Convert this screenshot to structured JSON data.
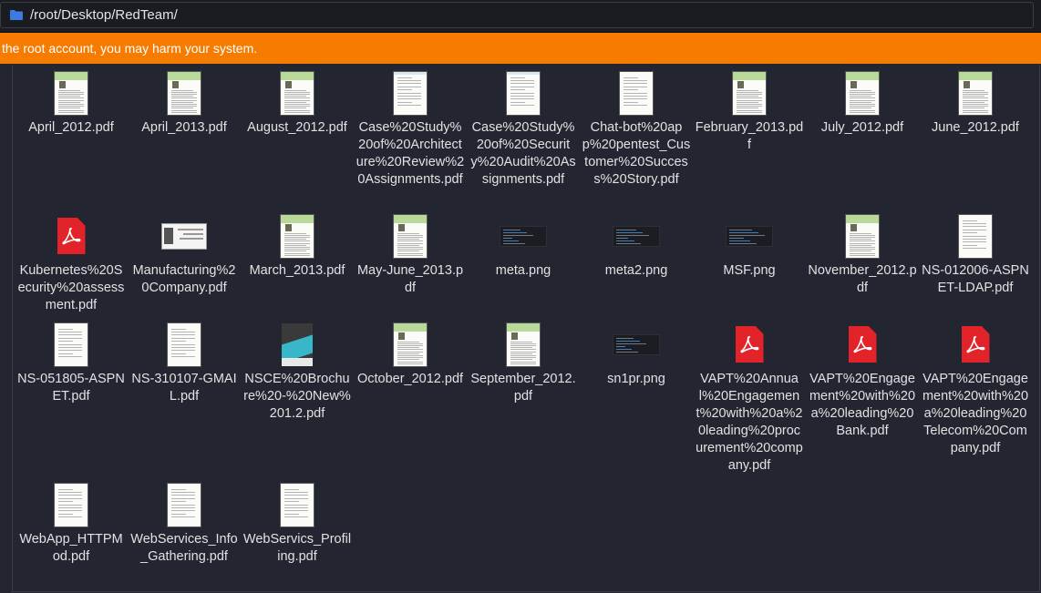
{
  "path": "/root/Desktop/RedTeam/",
  "warning": "the root account, you may harm your system.",
  "files": [
    {
      "name": "April_2012.pdf",
      "kind": "newsletter"
    },
    {
      "name": "April_2013.pdf",
      "kind": "newsletter"
    },
    {
      "name": "August_2012.pdf",
      "kind": "newsletter"
    },
    {
      "name": "Case%20Study%20of%20Architecture%20Review%20Assignments.pdf",
      "kind": "blue"
    },
    {
      "name": "Case%20Study%20of%20Security%20Audit%20Assignments.pdf",
      "kind": "blue"
    },
    {
      "name": "Chat-bot%20app%20pentest_Customer%20Success%20Story.pdf",
      "kind": "plain"
    },
    {
      "name": "February_2013.pdf",
      "kind": "newsletter"
    },
    {
      "name": "July_2012.pdf",
      "kind": "newsletter"
    },
    {
      "name": "June_2012.pdf",
      "kind": "newsletter"
    },
    {
      "name": "Kubernetes%20Security%20assessment.pdf",
      "kind": "pdf-red"
    },
    {
      "name": "Manufacturing%20Company.pdf",
      "kind": "mfg"
    },
    {
      "name": "March_2013.pdf",
      "kind": "newsletter"
    },
    {
      "name": "May-June_2013.pdf",
      "kind": "newsletter"
    },
    {
      "name": "meta.png",
      "kind": "shot"
    },
    {
      "name": "meta2.png",
      "kind": "shot"
    },
    {
      "name": "MSF.png",
      "kind": "shot"
    },
    {
      "name": "November_2012.pdf",
      "kind": "newsletter"
    },
    {
      "name": "NS-012006-ASPNET-LDAP.pdf",
      "kind": "plain"
    },
    {
      "name": "NS-051805-ASPNET.pdf",
      "kind": "plain"
    },
    {
      "name": "NS-310107-GMAIL.pdf",
      "kind": "plain"
    },
    {
      "name": "NSCE%20Brochure%20-%20New%201.2.pdf",
      "kind": "brochure"
    },
    {
      "name": "October_2012.pdf",
      "kind": "newsletter"
    },
    {
      "name": "September_2012.pdf",
      "kind": "newsletter"
    },
    {
      "name": "sn1pr.png",
      "kind": "shot"
    },
    {
      "name": "VAPT%20Annual%20Engagement%20with%20a%20leading%20procurement%20company.pdf",
      "kind": "pdf-red"
    },
    {
      "name": "VAPT%20Engagement%20with%20a%20leading%20Bank.pdf",
      "kind": "pdf-red"
    },
    {
      "name": "VAPT%20Engagement%20with%20a%20leading%20Telecom%20Company.pdf",
      "kind": "pdf-red"
    },
    {
      "name": "WebApp_HTTPMod.pdf",
      "kind": "plain"
    },
    {
      "name": "WebServices_Info_Gathering.pdf",
      "kind": "plain"
    },
    {
      "name": "WebServics_Profiling.pdf",
      "kind": "plain"
    }
  ]
}
